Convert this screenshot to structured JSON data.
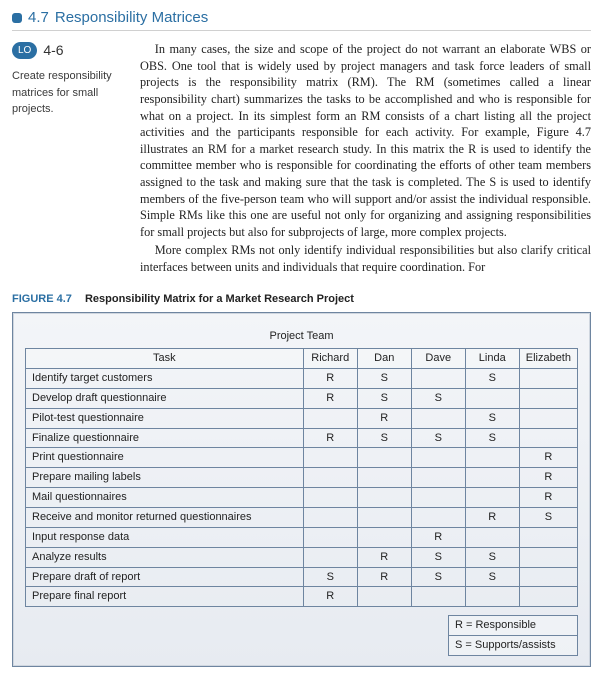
{
  "section": {
    "number": "4.7",
    "title": "Responsibility Matrices"
  },
  "lo": {
    "label": "LO",
    "range": "4-6",
    "caption": "Create responsibility matrices for small projects."
  },
  "paragraphs": [
    "In many cases, the size and scope of the project do not warrant an elaborate WBS or OBS. One tool that is widely used by project managers and task force leaders of small projects is the responsibility matrix (RM). The RM (sometimes called a linear responsibility chart) summarizes the tasks to be accomplished and who is responsible for what on a project. In its simplest form an RM consists of a chart listing all the project activities and the participants responsible for each activity. For example, Figure 4.7 illustrates an RM for a market research study. In this matrix the R is used to identify the committee member who is responsible for coordinating the efforts of other team members assigned to the task and making sure that the task is completed. The S is used to identify members of the five-person team who will support and/or assist the individual responsible. Simple RMs like this one are useful not only for organizing and assigning responsibilities for small projects but also for subprojects of large, more complex projects.",
    "More complex RMs not only identify individual responsibilities but also clarify critical interfaces between units and individuals that require coordination. For"
  ],
  "figure": {
    "label": "FIGURE 4.7",
    "title": "Responsibility Matrix for a Market Research Project"
  },
  "chart_data": {
    "type": "table",
    "title": "Responsibility Matrix for a Market Research Project",
    "supertitle": "Project Team",
    "row_header": "Task",
    "columns": [
      "Richard",
      "Dan",
      "Dave",
      "Linda",
      "Elizabeth"
    ],
    "rows": [
      {
        "task": "Identify target customers",
        "values": [
          "R",
          "S",
          "",
          "S",
          ""
        ]
      },
      {
        "task": "Develop draft questionnaire",
        "values": [
          "R",
          "S",
          "S",
          "",
          ""
        ]
      },
      {
        "task": "Pilot-test questionnaire",
        "values": [
          "",
          "R",
          "",
          "S",
          ""
        ]
      },
      {
        "task": "Finalize questionnaire",
        "values": [
          "R",
          "S",
          "S",
          "S",
          ""
        ]
      },
      {
        "task": "Print questionnaire",
        "values": [
          "",
          "",
          "",
          "",
          "R"
        ]
      },
      {
        "task": "Prepare mailing labels",
        "values": [
          "",
          "",
          "",
          "",
          "R"
        ]
      },
      {
        "task": "Mail questionnaires",
        "values": [
          "",
          "",
          "",
          "",
          "R"
        ]
      },
      {
        "task": "Receive and monitor returned questionnaires",
        "values": [
          "",
          "",
          "",
          "R",
          "S"
        ]
      },
      {
        "task": "Input response data",
        "values": [
          "",
          "",
          "R",
          "",
          ""
        ]
      },
      {
        "task": "Analyze results",
        "values": [
          "",
          "R",
          "S",
          "S",
          ""
        ]
      },
      {
        "task": "Prepare draft of report",
        "values": [
          "S",
          "R",
          "S",
          "S",
          ""
        ]
      },
      {
        "task": "Prepare final report",
        "values": [
          "R",
          "",
          "",
          "",
          ""
        ]
      }
    ],
    "legend": [
      "R = Responsible",
      "S = Supports/assists"
    ]
  }
}
